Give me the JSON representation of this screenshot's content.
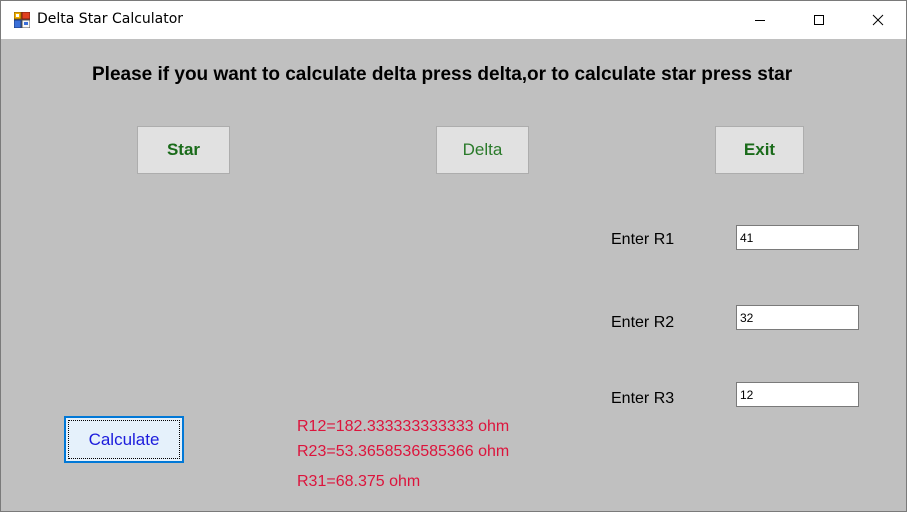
{
  "window": {
    "title": "Delta Star Calculator",
    "icon": "winforms-app-icon"
  },
  "instruction": "Please if you want to calculate delta press delta,or to calculate star press star",
  "buttons": {
    "star": "Star",
    "delta": "Delta",
    "exit": "Exit",
    "calculate": "Calculate"
  },
  "fields": {
    "r1": {
      "label": "Enter R1",
      "value": "41"
    },
    "r2": {
      "label": "Enter R2",
      "value": "32"
    },
    "r3": {
      "label": "Enter R3",
      "value": "12"
    }
  },
  "results": {
    "r12": "R12=182.333333333333 ohm",
    "r23": "R23=53.3658536585366 ohm",
    "r31": "R31=68.375 ohm"
  },
  "colors": {
    "form_background": "#c0c0c0",
    "button_text_green": "#1a6b1a",
    "result_text": "#dc143c",
    "calculate_text": "#1c1cdc",
    "focus_border": "#0078d7"
  }
}
